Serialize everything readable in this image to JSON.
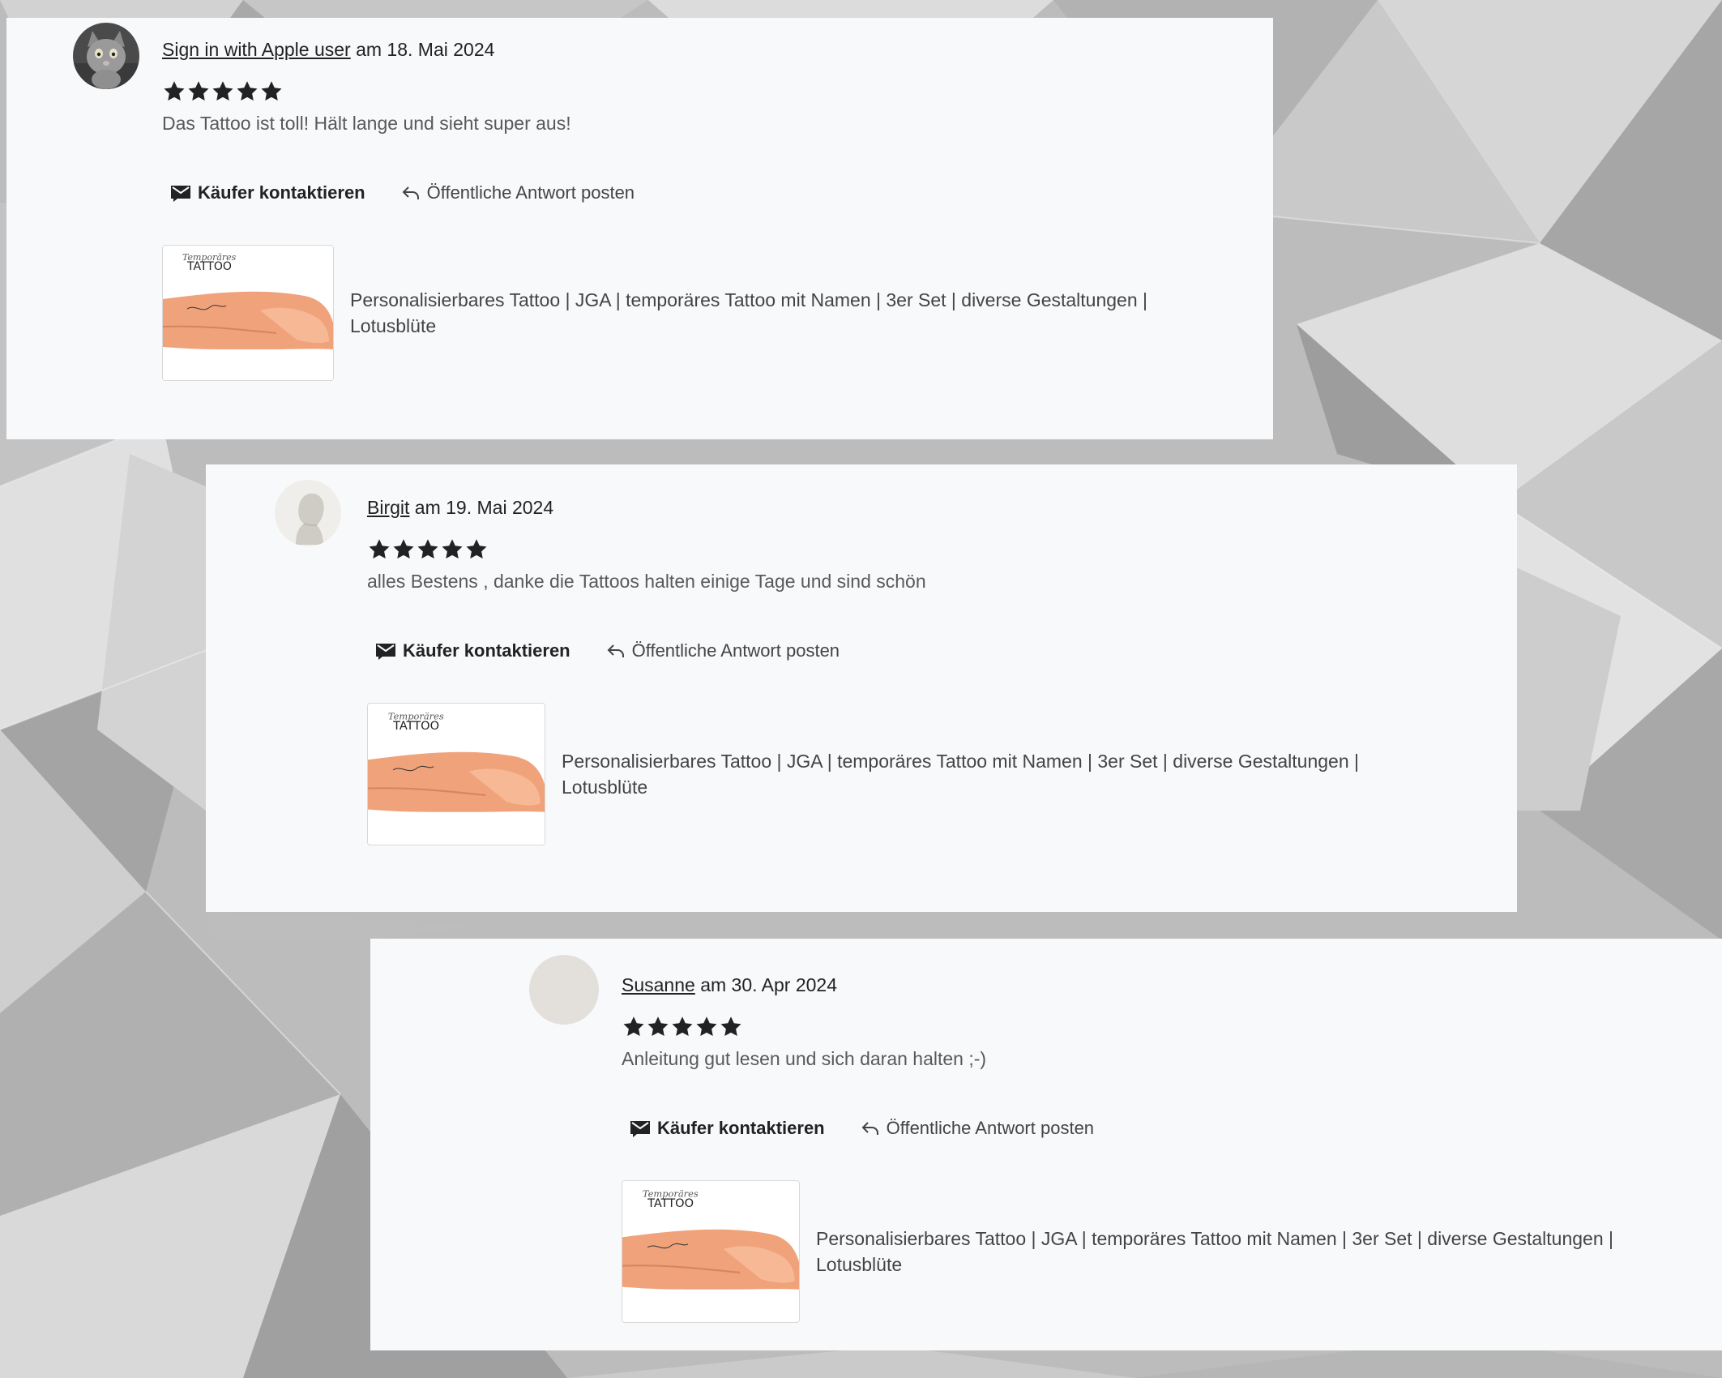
{
  "reviews": [
    {
      "reviewer": "Sign in with Apple user",
      "date_text": " am 18. Mai 2024",
      "rating": 5,
      "text": "Das Tattoo ist toll! Hält lange und sieht super aus!",
      "avatar": "cat-photo",
      "contact_label": "Käufer kontaktieren",
      "reply_label": "Öffentliche Antwort posten",
      "thumb_label": "TATTOO",
      "thumb_script": "Temporäres",
      "listing_title": "Personalisierbares Tattoo | JGA | temporäres Tattoo mit Namen | 3er Set | diverse Gestaltungen | Lotusblüte"
    },
    {
      "reviewer": "Birgit",
      "date_text": " am 19. Mai 2024",
      "rating": 5,
      "text": "alles Bestens , danke die Tattoos halten einige Tage und sind schön",
      "avatar": "default-person",
      "contact_label": "Käufer kontaktieren",
      "reply_label": "Öffentliche Antwort posten",
      "thumb_label": "TATTOO",
      "thumb_script": "Temporäres",
      "listing_title": "Personalisierbares Tattoo | JGA | temporäres Tattoo mit Namen | 3er Set | diverse Gestaltungen | Lotusblüte"
    },
    {
      "reviewer": "Susanne",
      "date_text": " am 30. Apr 2024",
      "rating": 5,
      "text": "Anleitung gut lesen und sich daran halten ;-)",
      "avatar": "blank",
      "contact_label": "Käufer kontaktieren",
      "reply_label": "Öffentliche Antwort posten",
      "thumb_label": "TATTOO",
      "thumb_script": "Temporäres",
      "listing_title": "Personalisierbares Tattoo | JGA | temporäres Tattoo mit Namen | 3er Set | diverse Gestaltungen | Lotusblüte"
    }
  ],
  "icons": {
    "star": "star-icon",
    "contact": "envelope-icon",
    "reply": "reply-arrow-icon"
  },
  "colors": {
    "card_bg": "#f8f9fb",
    "star": "#222222",
    "text_primary": "#222222",
    "text_secondary": "#595959",
    "skin": "#f0a27a"
  }
}
